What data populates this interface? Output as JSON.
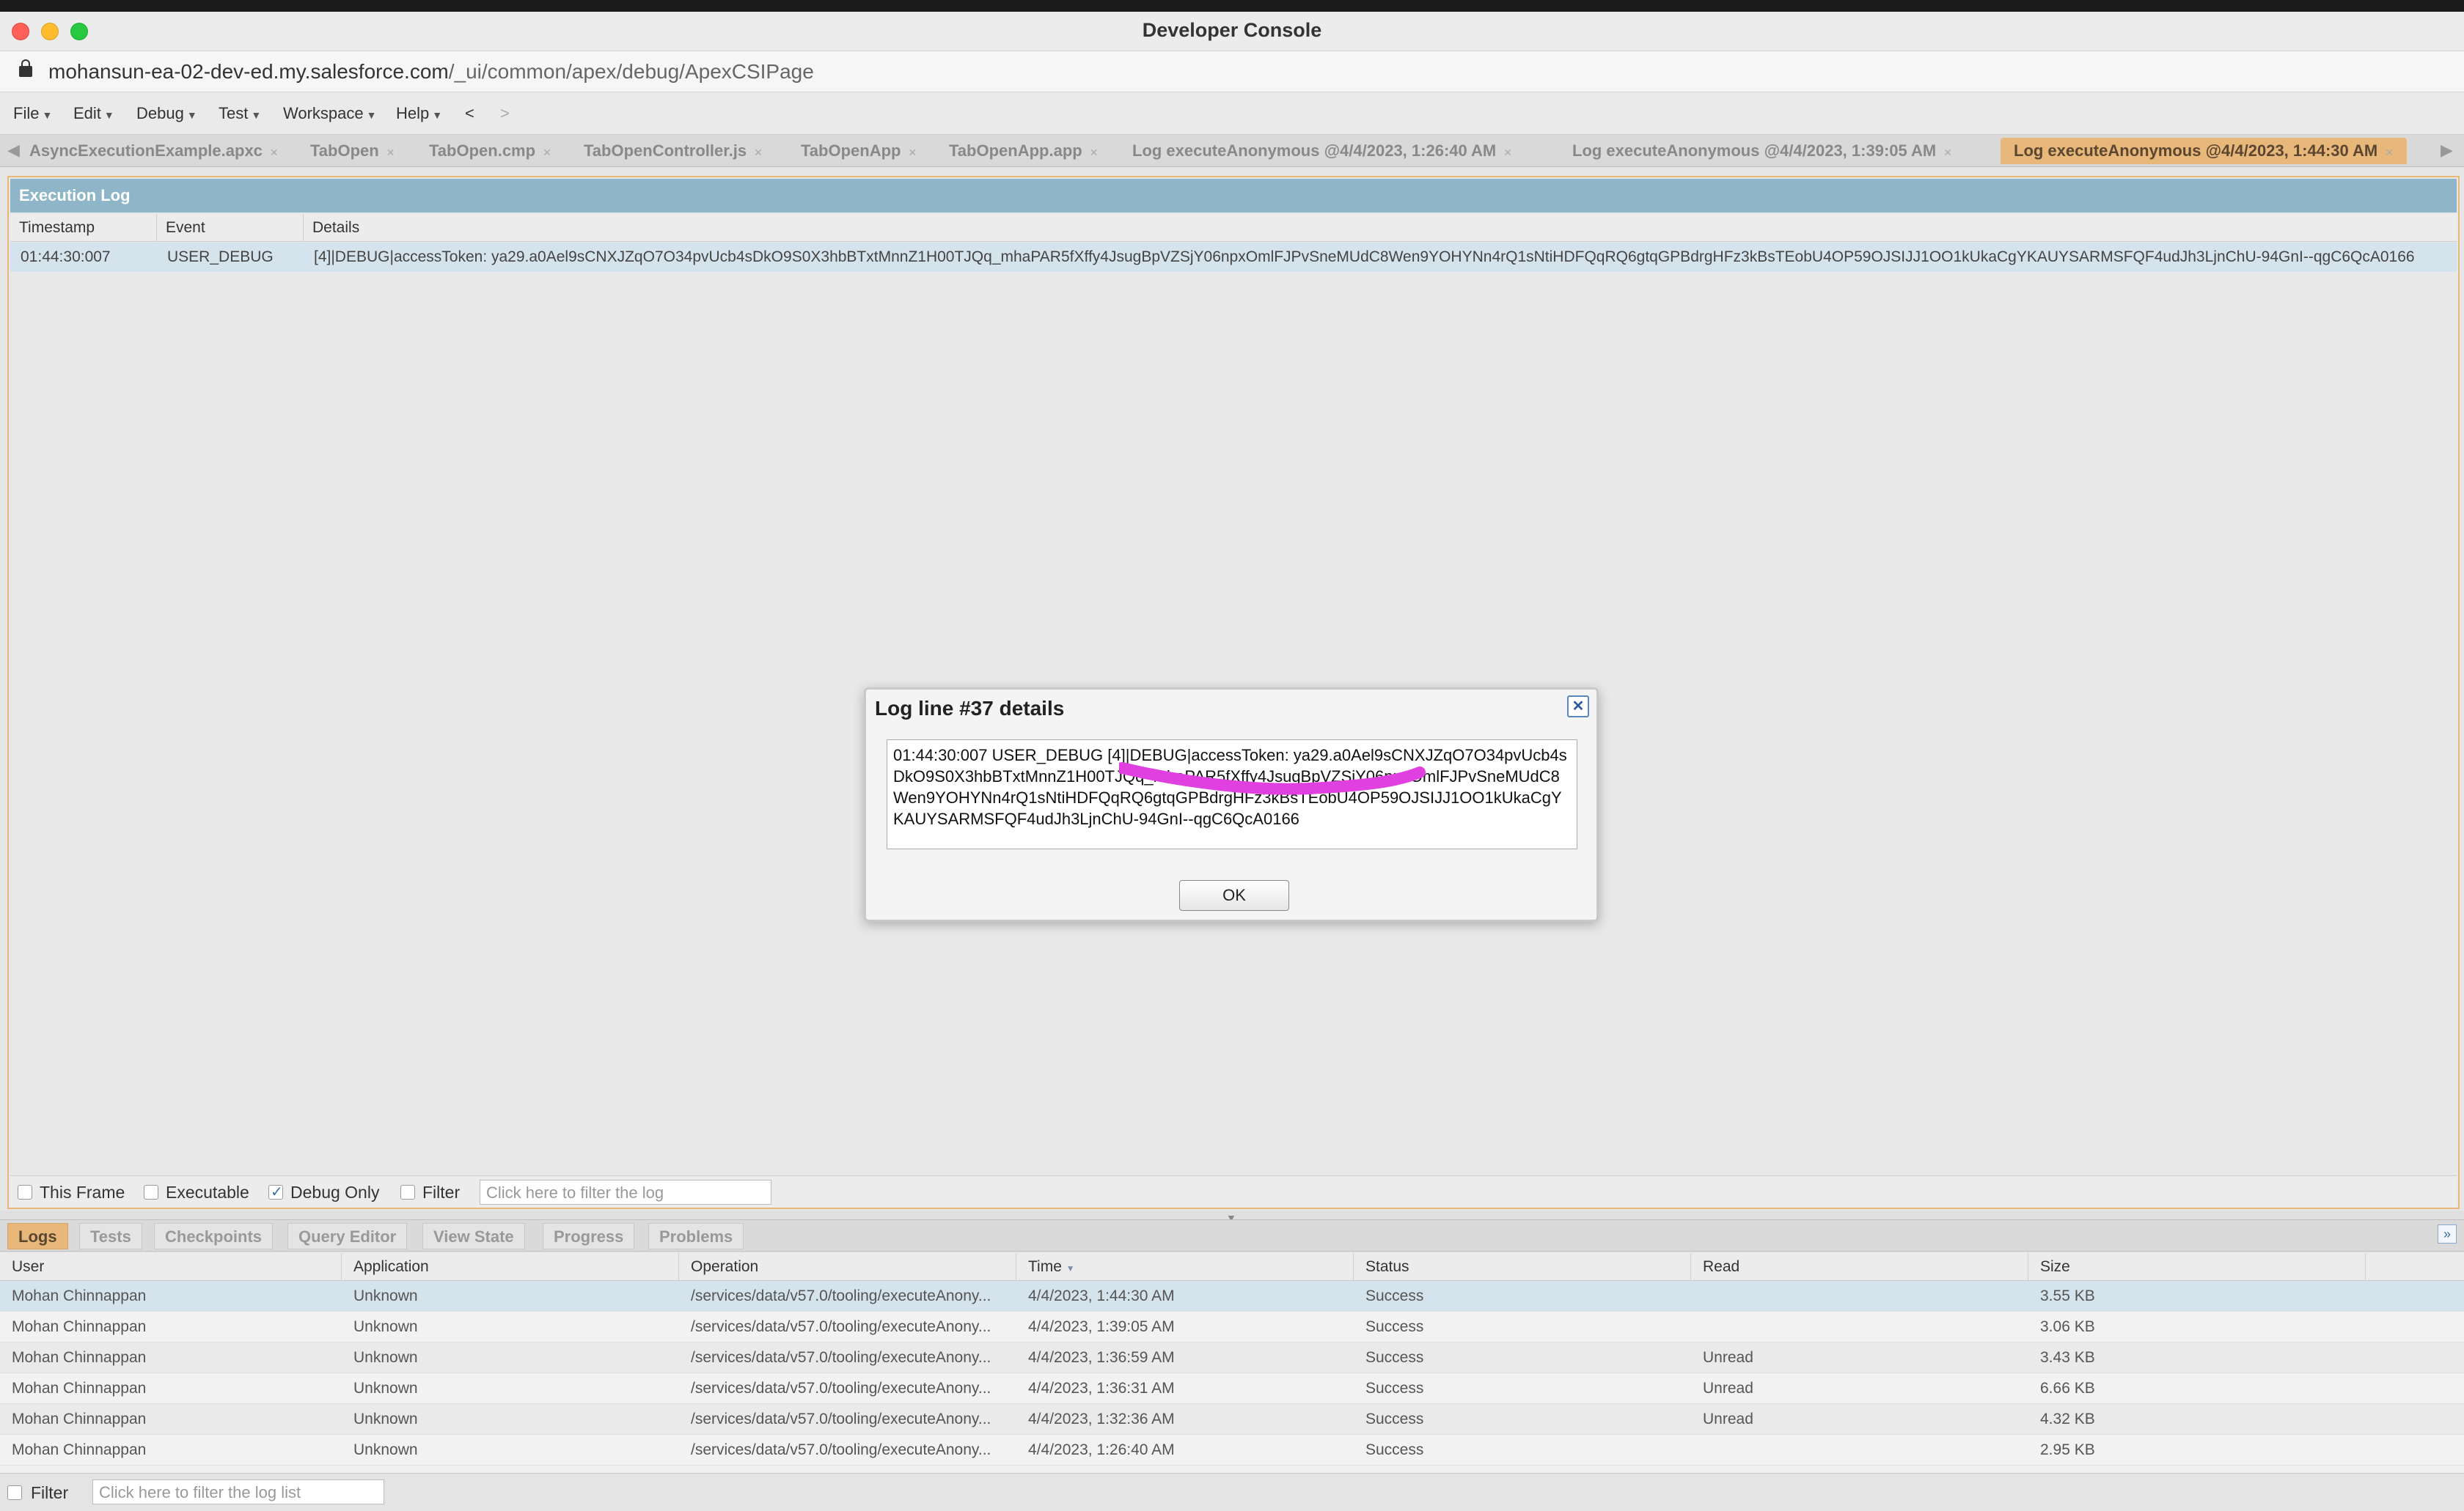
{
  "window": {
    "title": "Developer Console"
  },
  "address": {
    "host": "mohansun-ea-02-dev-ed.my.salesforce.com",
    "path": "/_ui/common/apex/debug/ApexCSIPage"
  },
  "menu": {
    "items": [
      "File",
      "Edit",
      "Debug",
      "Test",
      "Workspace",
      "Help"
    ],
    "back": "<",
    "forward": ">"
  },
  "editor_tabs": [
    "AsyncExecutionExample.apxc",
    "TabOpen",
    "TabOpen.cmp",
    "TabOpenController.js",
    "TabOpenApp",
    "TabOpenApp.app",
    "Log executeAnonymous @4/4/2023, 1:26:40 AM",
    "Log executeAnonymous @4/4/2023, 1:39:05 AM",
    "Log executeAnonymous @4/4/2023, 1:44:30 AM"
  ],
  "execution_log": {
    "header": "Execution Log",
    "columns": [
      "Timestamp",
      "Event",
      "Details"
    ],
    "row": {
      "timestamp": "01:44:30:007",
      "event": "USER_DEBUG",
      "details": "[4]|DEBUG|accessToken: ya29.a0Ael9sCNXJZqO7O34pvUcb4sDkO9S0X3hbBTxtMnnZ1H00TJQq_mhaPAR5fXffy4JsugBpVZSjY06npxOmlFJPvSneMUdC8Wen9YOHYNn4rQ1sNtiHDFQqRQ6gtqGPBdrgHFz3kBsTEobU4OP59OJSIJJ1OO1kUkaCgYKAUYSARMSFQF4udJh3LjnChU-94GnI--qgC6QcA0166"
    },
    "filters": {
      "this_frame": "This Frame",
      "executable": "Executable",
      "debug_only": "Debug Only",
      "filter": "Filter",
      "filter_placeholder": "Click here to filter the log"
    }
  },
  "dialog": {
    "title": "Log line #37 details",
    "close": "✕",
    "text": "01:44:30:007 USER_DEBUG [4]|DEBUG|accessToken: ya29.a0Ael9sCNXJZqO7O34pvUcb4sDkO9S0X3hbBTxtMnnZ1H00TJQq_mhaPAR5fXffy4JsugBpVZSjY06npxOmlFJPvSneMUdC8Wen9YOHYNn4rQ1sNtiHDFQqRQ6gtqGPBdrgHFz3kBsTEobU4OP59OJSIJJ1OO1kUkaCgYKAUYSARMSFQF4udJh3LjnChU-94GnI--qgC6QcA0166",
    "ok": "OK"
  },
  "bottom_tabs": [
    "Logs",
    "Tests",
    "Checkpoints",
    "Query Editor",
    "View State",
    "Progress",
    "Problems"
  ],
  "log_list": {
    "columns": [
      "User",
      "Application",
      "Operation",
      "Time",
      "Status",
      "Read",
      "Size"
    ],
    "rows": [
      {
        "user": "Mohan Chinnappan",
        "application": "Unknown",
        "operation": "/services/data/v57.0/tooling/executeAnony...",
        "time": "4/4/2023, 1:44:30 AM",
        "status": "Success",
        "read": "",
        "size": "3.55 KB"
      },
      {
        "user": "Mohan Chinnappan",
        "application": "Unknown",
        "operation": "/services/data/v57.0/tooling/executeAnony...",
        "time": "4/4/2023, 1:39:05 AM",
        "status": "Success",
        "read": "",
        "size": "3.06 KB"
      },
      {
        "user": "Mohan Chinnappan",
        "application": "Unknown",
        "operation": "/services/data/v57.0/tooling/executeAnony...",
        "time": "4/4/2023, 1:36:59 AM",
        "status": "Success",
        "read": "Unread",
        "size": "3.43 KB"
      },
      {
        "user": "Mohan Chinnappan",
        "application": "Unknown",
        "operation": "/services/data/v57.0/tooling/executeAnony...",
        "time": "4/4/2023, 1:36:31 AM",
        "status": "Success",
        "read": "Unread",
        "size": "6.66 KB"
      },
      {
        "user": "Mohan Chinnappan",
        "application": "Unknown",
        "operation": "/services/data/v57.0/tooling/executeAnony...",
        "time": "4/4/2023, 1:32:36 AM",
        "status": "Success",
        "read": "Unread",
        "size": "4.32 KB"
      },
      {
        "user": "Mohan Chinnappan",
        "application": "Unknown",
        "operation": "/services/data/v57.0/tooling/executeAnony...",
        "time": "4/4/2023, 1:26:40 AM",
        "status": "Success",
        "read": "",
        "size": "2.95 KB"
      }
    ],
    "filter_label": "Filter",
    "filter_placeholder": "Click here to filter the log list"
  },
  "colors": {
    "accent_tab": "#e8b77a",
    "header_blue": "#8fb5c8",
    "selected_row": "#d4e3ec",
    "redaction": "#e040e0"
  }
}
